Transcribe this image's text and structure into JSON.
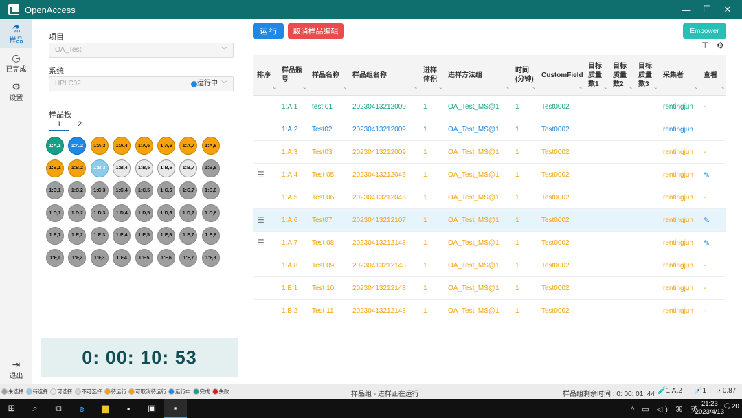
{
  "app": {
    "title": "OpenAccess"
  },
  "window_controls": {
    "minimize": "—",
    "maximize": "☐",
    "close": "✕"
  },
  "nav": {
    "items": [
      {
        "label": "样品",
        "icon": "flask-icon"
      },
      {
        "label": "已完成",
        "icon": "clock-icon"
      },
      {
        "label": "设置",
        "icon": "gear-icon"
      }
    ],
    "exit_label": "退出"
  },
  "panel": {
    "project_label": "项目",
    "project_value": "OA_Test",
    "system_label": "系统",
    "system_value": "HPLC02",
    "system_status": "运行中",
    "plate_label": "样品板",
    "plate_tabs": [
      "1",
      "2"
    ],
    "timer": "0: 00: 10: 53"
  },
  "wells": [
    [
      [
        "1:A,1",
        "green"
      ],
      [
        "1:A,2",
        "blue"
      ],
      [
        "1:A,3",
        "orange"
      ],
      [
        "1:A,4",
        "orange"
      ],
      [
        "1:A,5",
        "orange"
      ],
      [
        "1:A,6",
        "orange"
      ],
      [
        "1:A,7",
        "orange"
      ],
      [
        "1:A,8",
        "orange"
      ]
    ],
    [
      [
        "1:B,1",
        "orange"
      ],
      [
        "1:B,2",
        "orange"
      ],
      [
        "1:B,3",
        "lightblue"
      ],
      [
        "1:B,4",
        "light"
      ],
      [
        "1:B,5",
        "light"
      ],
      [
        "1:B,6",
        "light"
      ],
      [
        "1:B,7",
        "light"
      ],
      [
        "1:B,8",
        "grey"
      ]
    ],
    [
      [
        "1:C,1",
        "grey"
      ],
      [
        "1:C,2",
        "grey"
      ],
      [
        "1:C,3",
        "grey"
      ],
      [
        "1:C,4",
        "grey"
      ],
      [
        "1:C,5",
        "grey"
      ],
      [
        "1:C,6",
        "grey"
      ],
      [
        "1:C,7",
        "grey"
      ],
      [
        "1:C,8",
        "grey"
      ]
    ],
    [
      [
        "1:D,1",
        "grey"
      ],
      [
        "1:D,2",
        "grey"
      ],
      [
        "1:D,3",
        "grey"
      ],
      [
        "1:D,4",
        "grey"
      ],
      [
        "1:D,5",
        "grey"
      ],
      [
        "1:D,6",
        "grey"
      ],
      [
        "1:D,7",
        "grey"
      ],
      [
        "1:D,8",
        "grey"
      ]
    ],
    [
      [
        "1:E,1",
        "grey"
      ],
      [
        "1:E,2",
        "grey"
      ],
      [
        "1:E,3",
        "grey"
      ],
      [
        "1:E,4",
        "grey"
      ],
      [
        "1:E,5",
        "grey"
      ],
      [
        "1:E,6",
        "grey"
      ],
      [
        "1:E,7",
        "grey"
      ],
      [
        "1:E,8",
        "grey"
      ]
    ],
    [
      [
        "1:F,1",
        "grey"
      ],
      [
        "1:F,2",
        "grey"
      ],
      [
        "1:F,3",
        "grey"
      ],
      [
        "1:F,4",
        "grey"
      ],
      [
        "1:F,5",
        "grey"
      ],
      [
        "1:F,6",
        "grey"
      ],
      [
        "1:F,7",
        "grey"
      ],
      [
        "1:F,8",
        "grey"
      ]
    ]
  ],
  "toolbar": {
    "run": "运 行",
    "cancel_edit": "取消样品编辑",
    "empower": "Empower"
  },
  "table": {
    "headers": [
      "排序",
      "样品瓶号",
      "样品名称",
      "样品组名称",
      "进样体积",
      "进样方法组",
      "时间(分钟)",
      "CustomField",
      "目标质量数1",
      "目标质量数2",
      "目标质量数3",
      "采集者",
      "查看"
    ],
    "header_lines": [
      [
        "排序"
      ],
      [
        "样品瓶",
        "号"
      ],
      [
        "样品名称"
      ],
      [
        "样品组名称"
      ],
      [
        "进样",
        "体积"
      ],
      [
        "进样方法组"
      ],
      [
        "时间",
        "(分钟)"
      ],
      [
        "CustomField"
      ],
      [
        "目标",
        "质量",
        "数1"
      ],
      [
        "目标",
        "质量",
        "数2"
      ],
      [
        "目标",
        "质量",
        "数3"
      ],
      [
        "采集者"
      ],
      [
        "查看"
      ]
    ],
    "rows": [
      {
        "status": "green",
        "drag": false,
        "vial": "1:A,1",
        "name": "test 01",
        "group": "20230413212009",
        "vol": "1",
        "method": "OA_Test_MS@1",
        "time": "1",
        "custom": "Test0002",
        "m1": "",
        "m2": "",
        "m3": "",
        "collector": "rentingjun",
        "view": "-"
      },
      {
        "status": "blue",
        "drag": false,
        "vial": "1:A,2",
        "name": "Test02",
        "group": "20230413212009",
        "vol": "1",
        "method": "OA_Test_MS@1",
        "time": "1",
        "custom": "Test0002",
        "m1": "",
        "m2": "",
        "m3": "",
        "collector": "rentingjun",
        "view": ""
      },
      {
        "status": "orange",
        "drag": false,
        "vial": "1:A,3",
        "name": "Test03",
        "group": "20230413212009",
        "vol": "1",
        "method": "OA_Test_MS@1",
        "time": "1",
        "custom": "Test0002",
        "m1": "",
        "m2": "",
        "m3": "",
        "collector": "rentingjun",
        "view": "-"
      },
      {
        "status": "orange",
        "drag": true,
        "vial": "1:A,4",
        "name": "Test 05",
        "group": "20230413212046",
        "vol": "1",
        "method": "OA_Test_MS@1",
        "time": "1",
        "custom": "Test0002",
        "m1": "",
        "m2": "",
        "m3": "",
        "collector": "rentingjun",
        "view": "edit"
      },
      {
        "status": "orange",
        "drag": false,
        "vial": "1:A,5",
        "name": "Test 06",
        "group": "20230413212046",
        "vol": "1",
        "method": "OA_Test_MS@1",
        "time": "1",
        "custom": "Test0002",
        "m1": "",
        "m2": "",
        "m3": "",
        "collector": "rentingjun",
        "view": "-"
      },
      {
        "status": "orange",
        "drag": true,
        "vial": "1:A,6",
        "name": "Test07",
        "group": "20230413212107",
        "vol": "1",
        "method": "OA_Test_MS@1",
        "time": "1",
        "custom": "Test0002",
        "m1": "",
        "m2": "",
        "m3": "",
        "collector": "rentingjun",
        "view": "edit",
        "selected": true
      },
      {
        "status": "orange",
        "drag": true,
        "vial": "1:A,7",
        "name": "Test 08",
        "group": "20230413212148",
        "vol": "1",
        "method": "OA_Test_MS@1",
        "time": "1",
        "custom": "Test0002",
        "m1": "",
        "m2": "",
        "m3": "",
        "collector": "rentingjun",
        "view": "edit"
      },
      {
        "status": "orange",
        "drag": false,
        "vial": "1:A,8",
        "name": "Test 09",
        "group": "20230413212148",
        "vol": "1",
        "method": "OA_Test_MS@1",
        "time": "1",
        "custom": "Test0002",
        "m1": "",
        "m2": "",
        "m3": "",
        "collector": "rentingjun",
        "view": "-"
      },
      {
        "status": "orange",
        "drag": false,
        "vial": "1:B,1",
        "name": "Test 10",
        "group": "20230413212148",
        "vol": "1",
        "method": "OA_Test_MS@1",
        "time": "1",
        "custom": "Test0002",
        "m1": "",
        "m2": "",
        "m3": "",
        "collector": "rentingjun",
        "view": "-"
      },
      {
        "status": "orange",
        "drag": false,
        "vial": "1:B,2",
        "name": "Test 11",
        "group": "20230413212148",
        "vol": "1",
        "method": "OA_Test_MS@1",
        "time": "1",
        "custom": "Test0002",
        "m1": "",
        "m2": "",
        "m3": "",
        "collector": "rentingjun",
        "view": "-"
      }
    ]
  },
  "legend": [
    {
      "label": "未选择",
      "color": "#9e9e9e"
    },
    {
      "label": "待选择",
      "color": "#8ccbeb"
    },
    {
      "label": "可选择",
      "color": "#e8e8e8"
    },
    {
      "label": "不可选择",
      "color": "#d4d4d4"
    },
    {
      "label": "待运行",
      "color": "#f5a20c"
    },
    {
      "label": "可取消待运行",
      "color": "#f5a20c"
    },
    {
      "label": "运行中",
      "color": "#1e88e5"
    },
    {
      "label": "完成",
      "color": "#16a085"
    },
    {
      "label": "失败",
      "color": "#e21b1b"
    }
  ],
  "statusbar": {
    "center": "样品组 - 进样正在运行",
    "remaining": "样品组剩余时间 : 0: 00: 01: 44",
    "position": "1:A,2",
    "count": "1",
    "score": "0.87"
  },
  "taskbar": {
    "time": "21:23",
    "date": "2023/4/13",
    "ime": "英",
    "notifications": "20"
  },
  "colors": {
    "titlebar": "#0f6e6e",
    "run": "#1e88e5",
    "cancel": "#e84c4c",
    "empower": "#26c0b7"
  }
}
